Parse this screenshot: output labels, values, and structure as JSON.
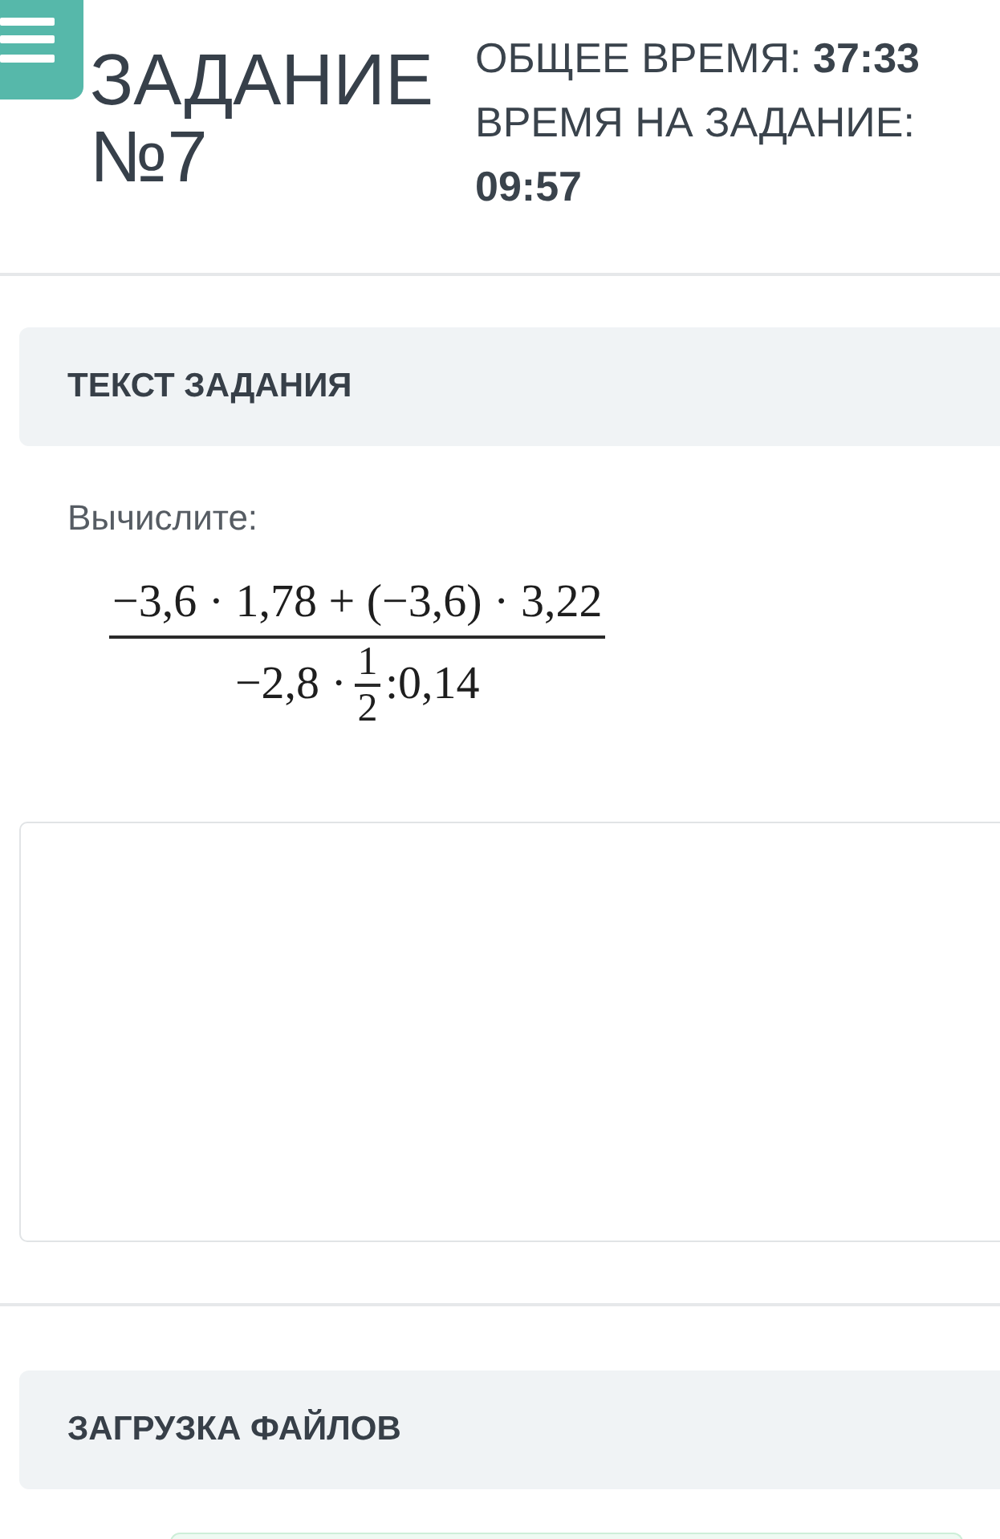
{
  "task": {
    "title": "ЗАДАНИЕ №7"
  },
  "timers": [
    {
      "label": "ОБЩЕЕ ВРЕМЯ:",
      "value": "37:33"
    },
    {
      "label": "ВРЕМЯ НА ЗАДАНИЕ:",
      "value": "09:57"
    }
  ],
  "task_text": {
    "heading": "ТЕКСТ ЗАДАНИЯ",
    "prompt": "Вычислите:",
    "formula": {
      "numerator": "−3,6 · 1,78 + (−3,6) · 3,22",
      "denominator_before": "−2,8 ·",
      "fraction": {
        "numerator": "1",
        "denominator": "2"
      },
      "denominator_after": ":0,14"
    }
  },
  "upload": {
    "heading": "ЗАГРУЗКА ФАЙЛОВ"
  }
}
